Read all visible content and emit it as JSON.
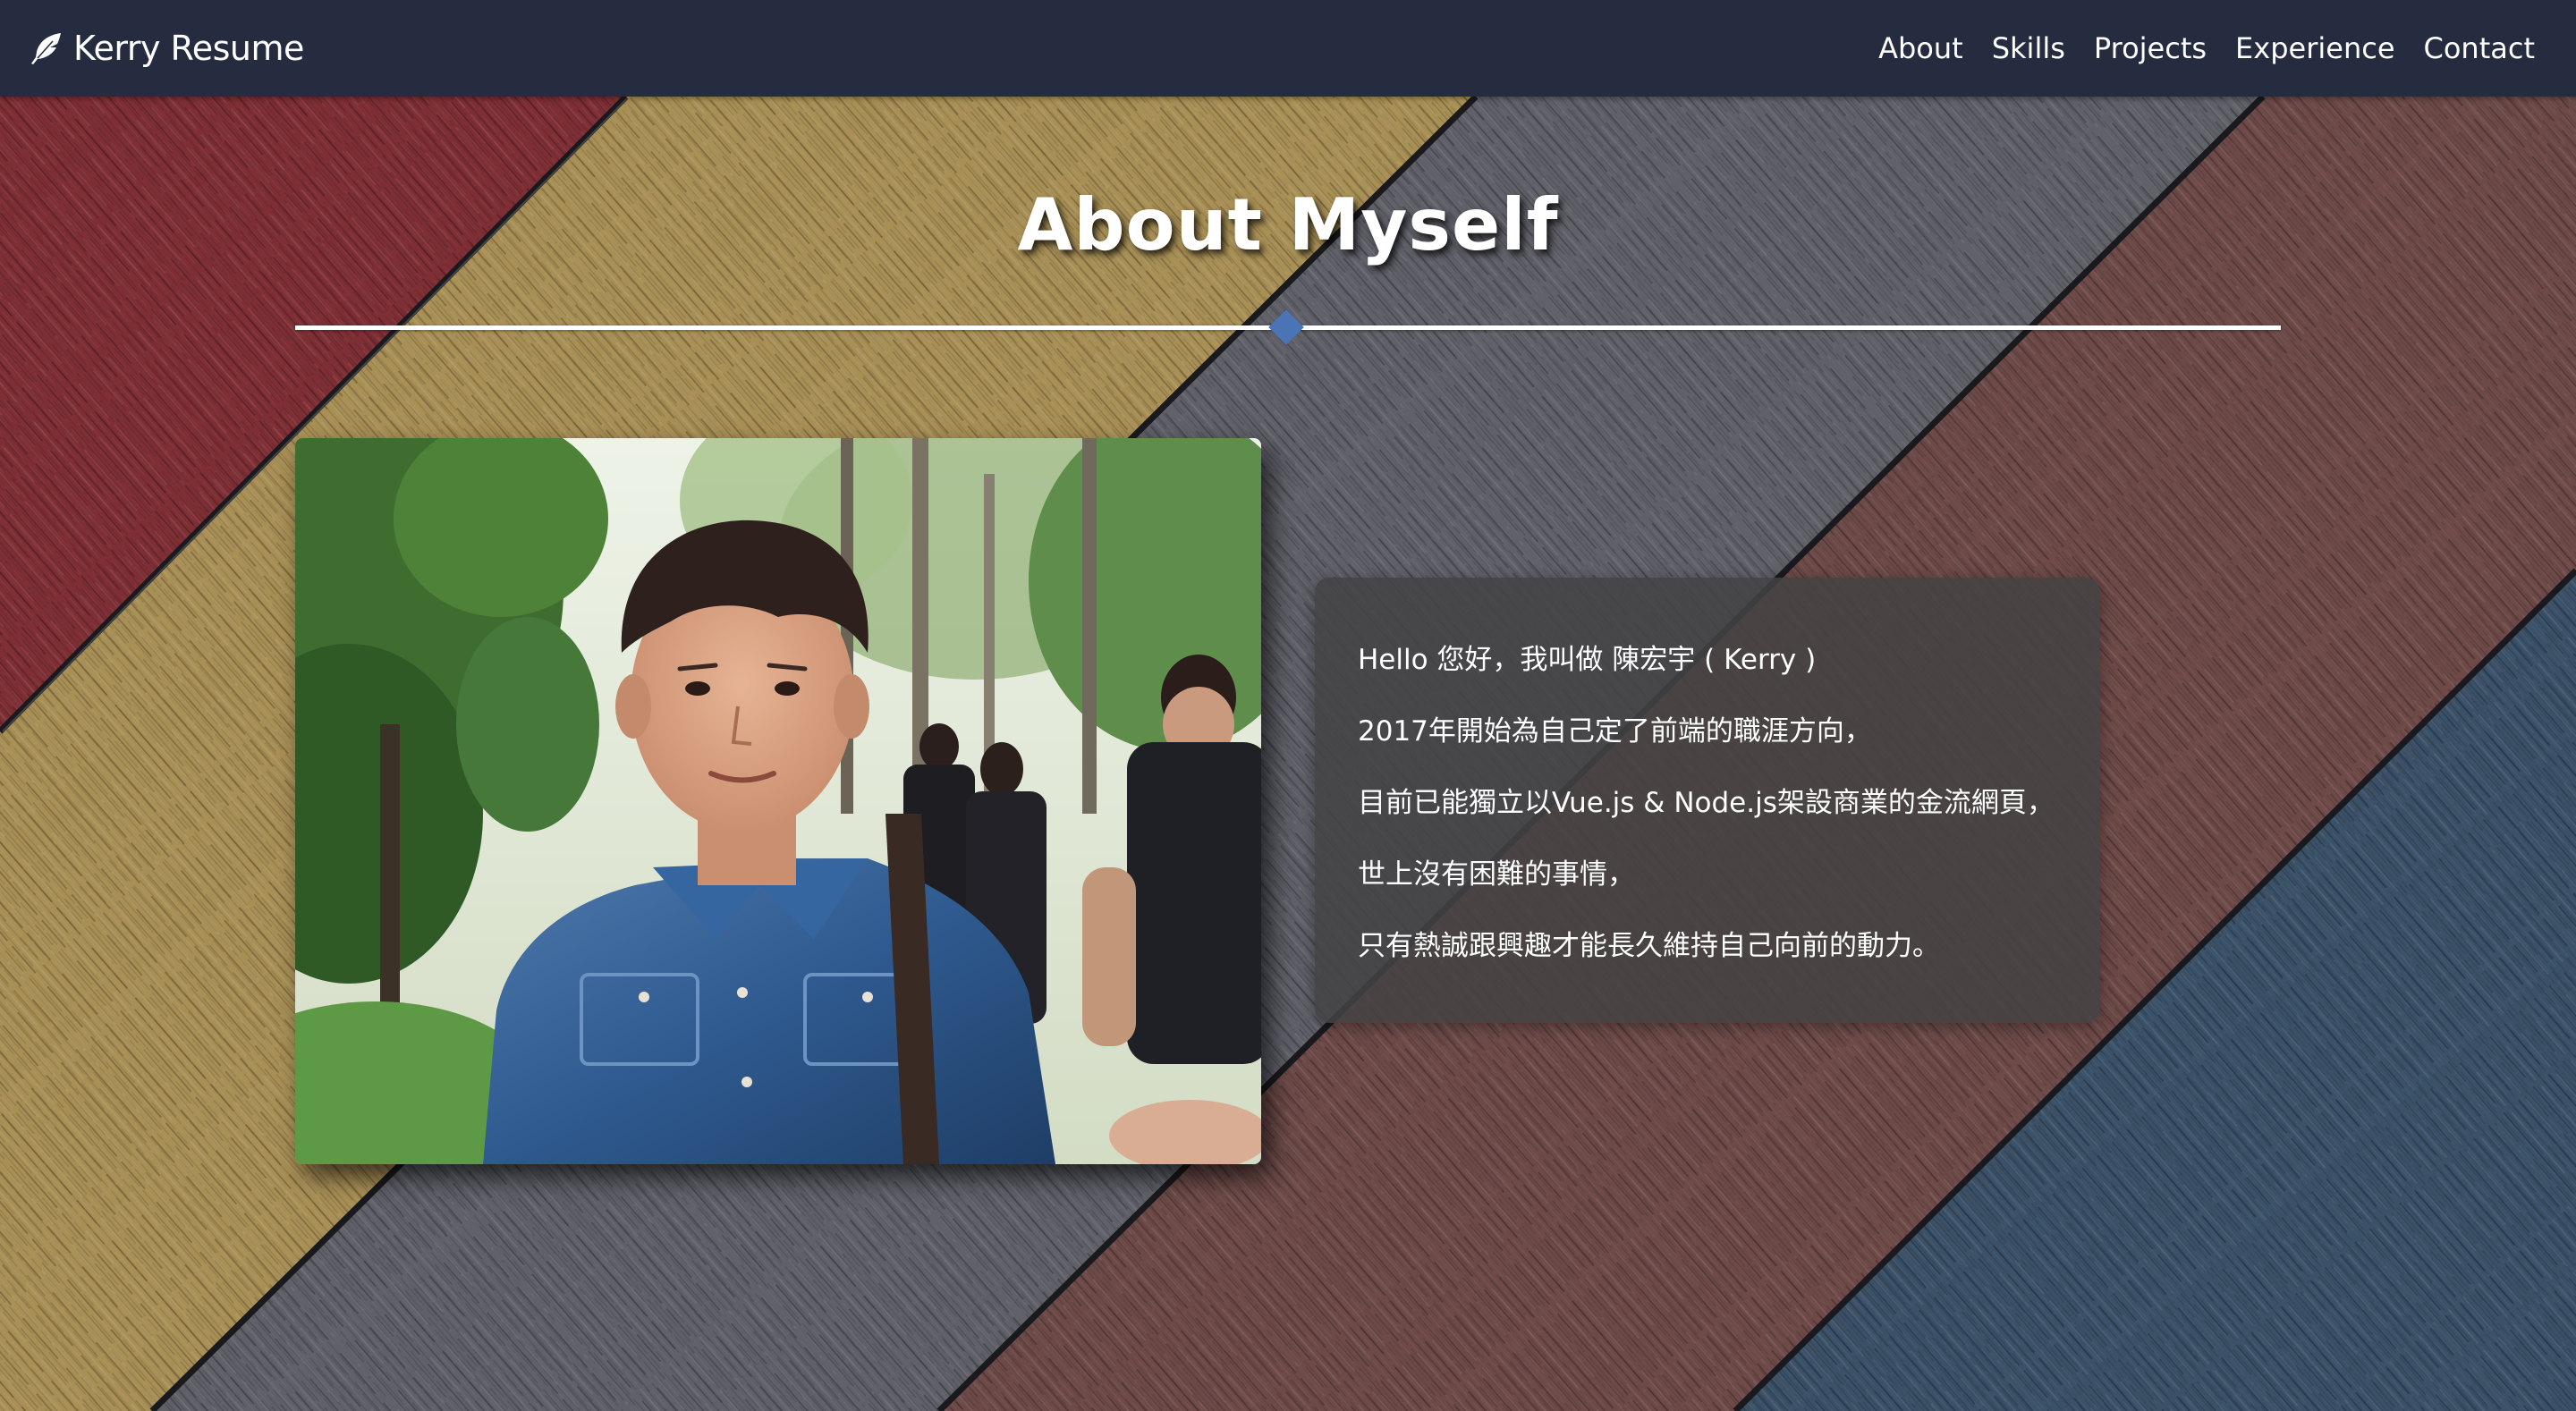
{
  "navbar": {
    "brand": "Kerry Resume",
    "brand_icon": "feather-icon",
    "links": [
      "About",
      "Skills",
      "Projects",
      "Experience",
      "Contact"
    ]
  },
  "about": {
    "title": "About Myself",
    "lines": [
      "Hello 您好，我叫做 陳宏宇 ( Kerry )",
      "2017年開始為自己定了前端的職涯方向，",
      "目前已能獨立以Vue.js & Node.js架設商業的金流網頁，",
      "世上沒有困難的事情，",
      "只有熱誠跟興趣才能長久維持自己向前的動力。"
    ]
  },
  "colors": {
    "navbar_bg": "#262c40",
    "accent": "#4a74b5",
    "wood_red": "#7e2f35",
    "wood_gold": "#a88f55",
    "wood_gray": "#5f6068",
    "wood_brown": "#6d4a48",
    "wood_blue": "#3a5168"
  }
}
